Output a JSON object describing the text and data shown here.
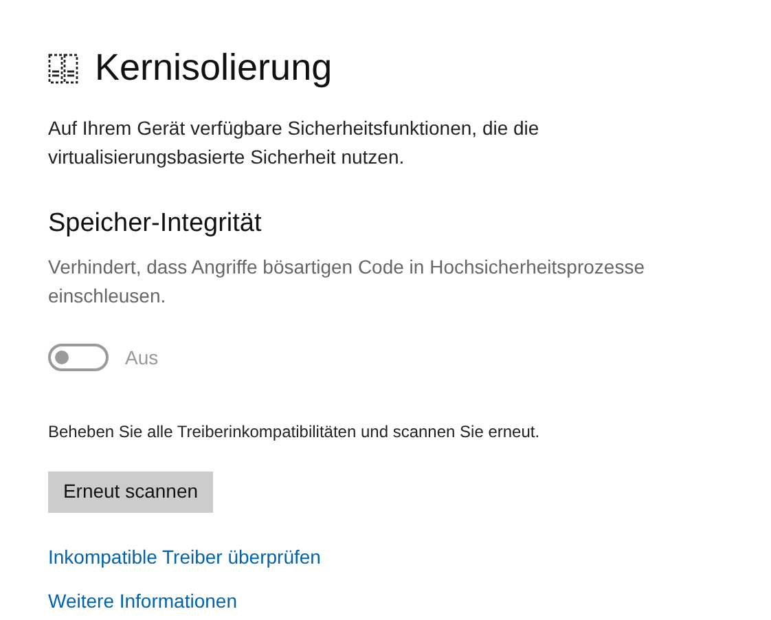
{
  "page": {
    "title": "Kernisolierung",
    "description": "Auf Ihrem Gerät verfügbare Sicherheitsfunktionen, die die virtualisierungsbasierte Sicherheit nutzen."
  },
  "section": {
    "title": "Speicher-Integrität",
    "description": "Verhindert, dass Angriffe bösartigen Code in Hochsicherheitsprozesse einschleusen.",
    "toggle": {
      "on": false,
      "disabled": true,
      "label": "Aus"
    }
  },
  "notice": "Beheben Sie alle Treiberinkompatibilitäten und scannen Sie erneut.",
  "button": "Erneut scannen",
  "links": [
    "Inkompatible Treiber überprüfen",
    "Weitere Informationen"
  ]
}
